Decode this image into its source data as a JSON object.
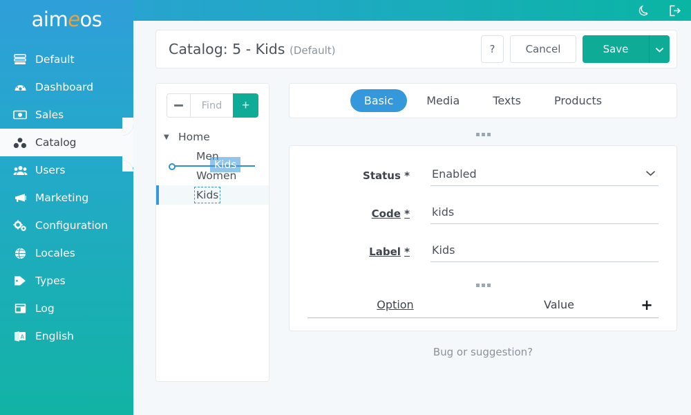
{
  "brand": {
    "logo_prefix": "aim",
    "logo_accent": "e",
    "logo_suffix": "os",
    "accent_color": "#e8a33d"
  },
  "colors": {
    "sidebar_top": "#2f9fd9",
    "sidebar_bottom": "#12b3a4",
    "primary_teal": "#0eab96",
    "primary_blue": "#3498db",
    "page_bg": "#f5f8fa"
  },
  "topbar": {
    "darkmode_icon": "moon-icon",
    "logout_icon": "logout-icon"
  },
  "sidebar": {
    "items": [
      {
        "label": "Default",
        "icon": "server-icon",
        "active": false
      },
      {
        "label": "Dashboard",
        "icon": "dashboard-icon",
        "active": false
      },
      {
        "label": "Sales",
        "icon": "money-icon",
        "active": false
      },
      {
        "label": "Catalog",
        "icon": "catalog-icon",
        "active": true
      },
      {
        "label": "Users",
        "icon": "users-icon",
        "active": false
      },
      {
        "label": "Marketing",
        "icon": "megaphone-icon",
        "active": false
      },
      {
        "label": "Configuration",
        "icon": "gears-icon",
        "active": false
      },
      {
        "label": "Locales",
        "icon": "globe-icon",
        "active": false
      },
      {
        "label": "Types",
        "icon": "tag-icon",
        "active": false
      },
      {
        "label": "Log",
        "icon": "log-icon",
        "active": false
      },
      {
        "label": "English",
        "icon": "language-icon",
        "active": false
      }
    ]
  },
  "header": {
    "title": "Catalog: 5 - Kids",
    "subtitle": "(Default)",
    "help_label": "?",
    "cancel_label": "Cancel",
    "save_label": "Save",
    "save_caret_icon": "chevron-down-icon"
  },
  "tree": {
    "collapse_icon": "minus-icon",
    "find_placeholder": "Find",
    "find_value": "",
    "add_label": "+",
    "nodes": [
      {
        "label": "Home",
        "level": 0,
        "expanded": true,
        "selected": false
      },
      {
        "label": "Men",
        "level": 1,
        "expanded": false,
        "selected": false
      },
      {
        "label": "Women",
        "level": 1,
        "expanded": false,
        "selected": false
      },
      {
        "label": "Kids",
        "level": 1,
        "expanded": false,
        "selected": true
      }
    ],
    "drag": {
      "active": true,
      "ghost_label": "Kids",
      "drop_indicator": "insert-line"
    }
  },
  "tabs": [
    {
      "label": "Basic",
      "active": true
    },
    {
      "label": "Media",
      "active": false
    },
    {
      "label": "Texts",
      "active": false
    },
    {
      "label": "Products",
      "active": false
    }
  ],
  "form": {
    "status": {
      "label": "Status",
      "required_mark": "*",
      "value": "Enabled",
      "underlined": false,
      "type": "select",
      "caret_icon": "chevron-down-icon"
    },
    "code": {
      "label": "Code",
      "required_mark": "*",
      "value": "kids",
      "underlined": true,
      "type": "text"
    },
    "label_field": {
      "label": "Label",
      "required_mark": "*",
      "value": "Kids",
      "underlined": true,
      "type": "text"
    },
    "options_table": {
      "col_option": "Option",
      "col_value": "Value",
      "add_label": "+",
      "rows": []
    }
  },
  "footer": {
    "link": "Bug or suggestion?"
  }
}
